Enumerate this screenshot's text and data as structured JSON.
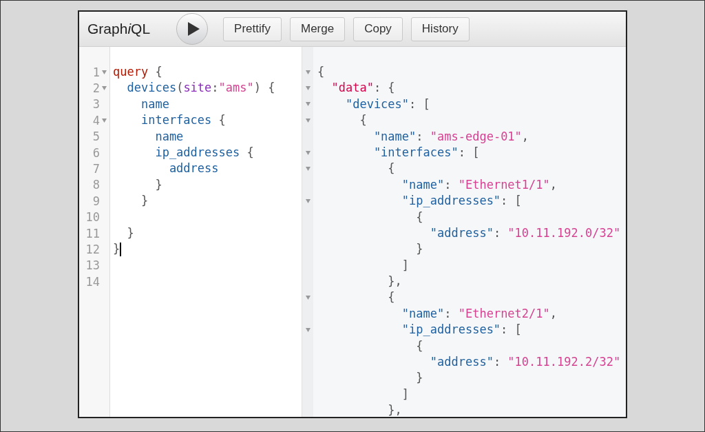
{
  "toolbar": {
    "logo": [
      {
        "text": "Graph",
        "italic": false
      },
      {
        "text": "i",
        "italic": true
      },
      {
        "text": "QL",
        "italic": false
      }
    ],
    "buttons": [
      {
        "label": "Prettify"
      },
      {
        "label": "Merge"
      },
      {
        "label": "Copy"
      },
      {
        "label": "History"
      }
    ]
  },
  "query_editor": {
    "lines": [
      {
        "number": "1",
        "foldable": true,
        "cursor": false,
        "tokens": [
          {
            "kind": "keyword",
            "text": "query"
          },
          {
            "kind": "punctuation",
            "text": " {"
          }
        ]
      },
      {
        "number": "2",
        "foldable": true,
        "cursor": false,
        "tokens": [
          {
            "kind": "field",
            "text": "  devices"
          },
          {
            "kind": "punctuation",
            "text": "("
          },
          {
            "kind": "attribute",
            "text": "site"
          },
          {
            "kind": "punctuation",
            "text": ":"
          },
          {
            "kind": "string",
            "text": "\"ams\""
          },
          {
            "kind": "punctuation",
            "text": ") {"
          }
        ]
      },
      {
        "number": "3",
        "foldable": false,
        "cursor": false,
        "tokens": [
          {
            "kind": "field",
            "text": "    name"
          }
        ]
      },
      {
        "number": "4",
        "foldable": true,
        "cursor": false,
        "tokens": [
          {
            "kind": "field",
            "text": "    interfaces"
          },
          {
            "kind": "punctuation",
            "text": " {"
          }
        ]
      },
      {
        "number": "5",
        "foldable": false,
        "cursor": false,
        "tokens": [
          {
            "kind": "field",
            "text": "      name"
          }
        ]
      },
      {
        "number": "6",
        "foldable": false,
        "cursor": false,
        "tokens": [
          {
            "kind": "field",
            "text": "      ip_addresses"
          },
          {
            "kind": "punctuation",
            "text": " {"
          }
        ]
      },
      {
        "number": "7",
        "foldable": false,
        "cursor": false,
        "tokens": [
          {
            "kind": "field",
            "text": "        address"
          }
        ]
      },
      {
        "number": "8",
        "foldable": false,
        "cursor": false,
        "tokens": [
          {
            "kind": "punctuation",
            "text": "      }"
          }
        ]
      },
      {
        "number": "9",
        "foldable": false,
        "cursor": false,
        "tokens": [
          {
            "kind": "punctuation",
            "text": "    }"
          }
        ]
      },
      {
        "number": "10",
        "foldable": false,
        "cursor": false
      },
      {
        "number": "11",
        "foldable": false,
        "cursor": false,
        "tokens": [
          {
            "kind": "punctuation",
            "text": "  }"
          }
        ]
      },
      {
        "number": "12",
        "foldable": false,
        "cursor": true,
        "tokens": [
          {
            "kind": "punctuation",
            "text": "}"
          }
        ]
      },
      {
        "number": "13",
        "foldable": false,
        "cursor": false
      },
      {
        "number": "14",
        "foldable": false,
        "cursor": false
      }
    ]
  },
  "result_viewer": {
    "lines": [
      {
        "foldable": true,
        "tokens": [
          {
            "kind": "punctuation",
            "text": "{"
          }
        ]
      },
      {
        "foldable": true,
        "tokens": [
          {
            "kind": "root-property",
            "text": "  \"data\""
          },
          {
            "kind": "punctuation",
            "text": ": {"
          }
        ]
      },
      {
        "foldable": true,
        "tokens": [
          {
            "kind": "property",
            "text": "    \"devices\""
          },
          {
            "kind": "punctuation",
            "text": ": ["
          }
        ]
      },
      {
        "foldable": true,
        "tokens": [
          {
            "kind": "punctuation",
            "text": "      {"
          }
        ]
      },
      {
        "foldable": false,
        "tokens": [
          {
            "kind": "property",
            "text": "        \"name\""
          },
          {
            "kind": "punctuation",
            "text": ": "
          },
          {
            "kind": "string",
            "text": "\"ams-edge-01\""
          },
          {
            "kind": "punctuation",
            "text": ","
          }
        ]
      },
      {
        "foldable": true,
        "tokens": [
          {
            "kind": "property",
            "text": "        \"interfaces\""
          },
          {
            "kind": "punctuation",
            "text": ": ["
          }
        ]
      },
      {
        "foldable": true,
        "tokens": [
          {
            "kind": "punctuation",
            "text": "          {"
          }
        ]
      },
      {
        "foldable": false,
        "tokens": [
          {
            "kind": "property",
            "text": "            \"name\""
          },
          {
            "kind": "punctuation",
            "text": ": "
          },
          {
            "kind": "string",
            "text": "\"Ethernet1/1\""
          },
          {
            "kind": "punctuation",
            "text": ","
          }
        ]
      },
      {
        "foldable": true,
        "tokens": [
          {
            "kind": "property",
            "text": "            \"ip_addresses\""
          },
          {
            "kind": "punctuation",
            "text": ": ["
          }
        ]
      },
      {
        "foldable": false,
        "tokens": [
          {
            "kind": "punctuation",
            "text": "              {"
          }
        ]
      },
      {
        "foldable": false,
        "tokens": [
          {
            "kind": "property",
            "text": "                \"address\""
          },
          {
            "kind": "punctuation",
            "text": ": "
          },
          {
            "kind": "string",
            "text": "\"10.11.192.0/32\""
          }
        ]
      },
      {
        "foldable": false,
        "tokens": [
          {
            "kind": "punctuation",
            "text": "              }"
          }
        ]
      },
      {
        "foldable": false,
        "tokens": [
          {
            "kind": "punctuation",
            "text": "            ]"
          }
        ]
      },
      {
        "foldable": false,
        "tokens": [
          {
            "kind": "punctuation",
            "text": "          },"
          }
        ]
      },
      {
        "foldable": true,
        "tokens": [
          {
            "kind": "punctuation",
            "text": "          {"
          }
        ]
      },
      {
        "foldable": false,
        "tokens": [
          {
            "kind": "property",
            "text": "            \"name\""
          },
          {
            "kind": "punctuation",
            "text": ": "
          },
          {
            "kind": "string",
            "text": "\"Ethernet2/1\""
          },
          {
            "kind": "punctuation",
            "text": ","
          }
        ]
      },
      {
        "foldable": true,
        "tokens": [
          {
            "kind": "property",
            "text": "            \"ip_addresses\""
          },
          {
            "kind": "punctuation",
            "text": ": ["
          }
        ]
      },
      {
        "foldable": false,
        "tokens": [
          {
            "kind": "punctuation",
            "text": "              {"
          }
        ]
      },
      {
        "foldable": false,
        "tokens": [
          {
            "kind": "property",
            "text": "                \"address\""
          },
          {
            "kind": "punctuation",
            "text": ": "
          },
          {
            "kind": "string",
            "text": "\"10.11.192.2/32\""
          }
        ]
      },
      {
        "foldable": false,
        "tokens": [
          {
            "kind": "punctuation",
            "text": "              }"
          }
        ]
      },
      {
        "foldable": false,
        "tokens": [
          {
            "kind": "punctuation",
            "text": "            ]"
          }
        ]
      },
      {
        "foldable": false,
        "tokens": [
          {
            "kind": "punctuation",
            "text": "          },"
          }
        ]
      }
    ]
  }
}
